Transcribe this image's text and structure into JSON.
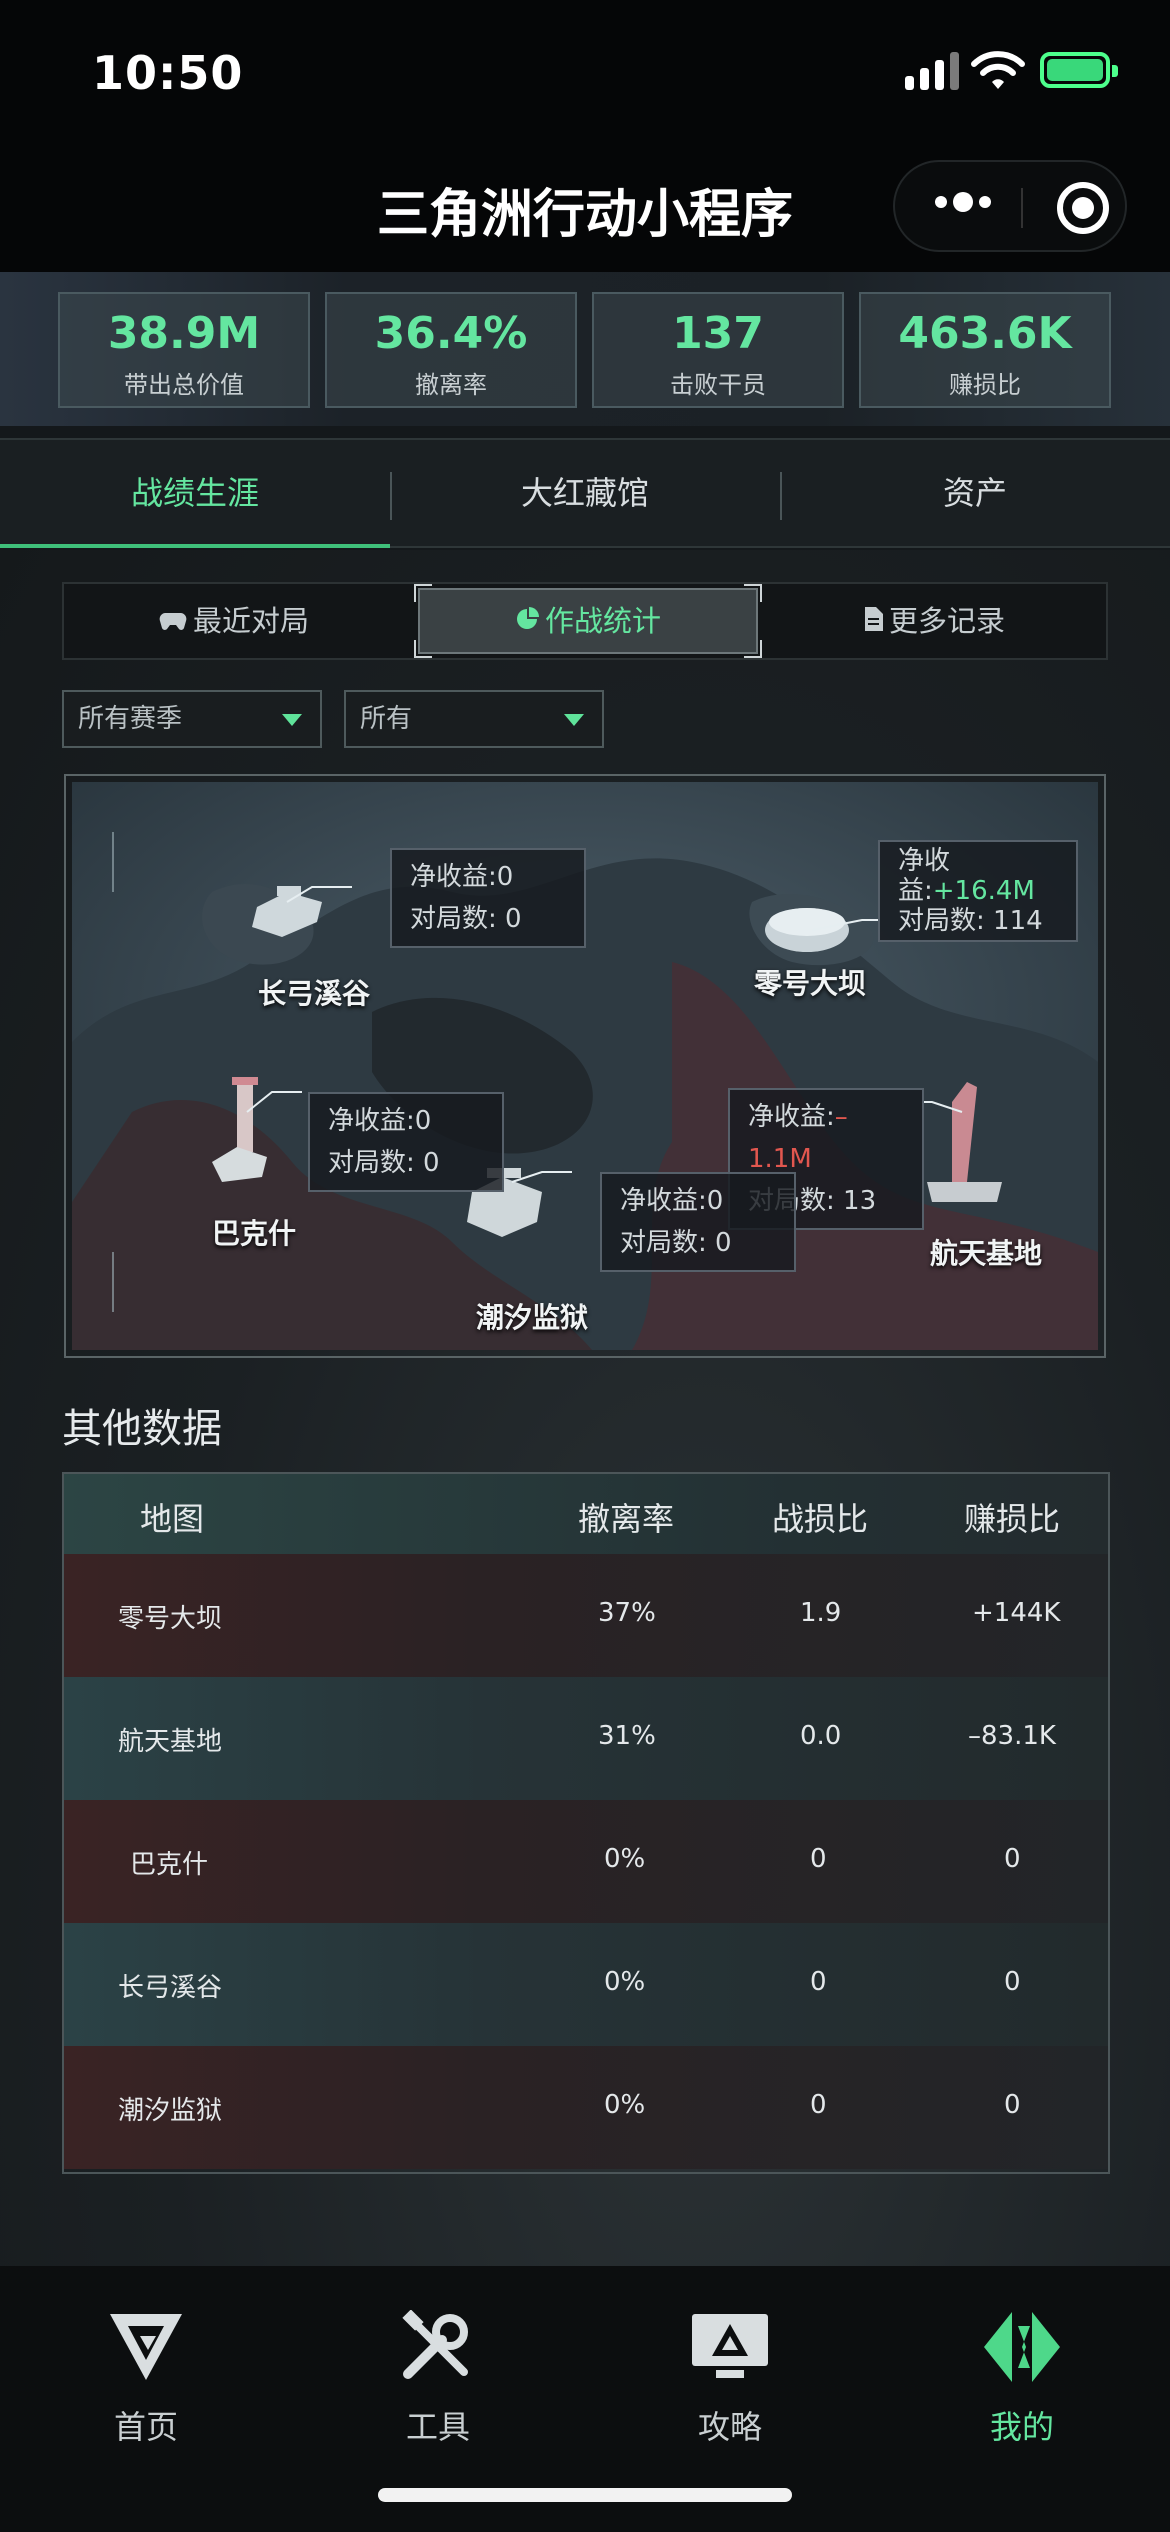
{
  "status_bar": {
    "time": "10:50"
  },
  "header": {
    "title": "三角洲行动小程序"
  },
  "stats": [
    {
      "value": "38.9M",
      "label": "带出总价值"
    },
    {
      "value": "36.4%",
      "label": "撤离率"
    },
    {
      "value": "137",
      "label": "击败干员"
    },
    {
      "value": "463.6K",
      "label": "赚损比"
    }
  ],
  "main_tabs": [
    {
      "label": "战绩生涯",
      "active": true
    },
    {
      "label": "大红藏馆",
      "active": false
    },
    {
      "label": "资产",
      "active": false
    }
  ],
  "sub_tabs": [
    {
      "label": "最近对局",
      "icon": "gamepad-icon"
    },
    {
      "label": "作战统计",
      "icon": "pie-chart-icon",
      "active": true
    },
    {
      "label": "更多记录",
      "icon": "document-icon"
    }
  ],
  "filters": {
    "season": "所有赛季",
    "mode": "所有"
  },
  "map_points": {
    "changgong": {
      "name": "长弓溪谷",
      "income_label": "净收益:",
      "income": "0",
      "matches_label": "对局数: ",
      "matches": "0"
    },
    "linghao": {
      "name": "零号大坝",
      "income_label": "净收",
      "income_label2": "益:",
      "income": "+16.4M",
      "matches_label": "对局数: ",
      "matches": "114"
    },
    "bakeshi": {
      "name": "巴克什",
      "income_label": "净收益:",
      "income": "0",
      "matches_label": "对局数: ",
      "matches": "0"
    },
    "hangtian": {
      "name": "航天基地",
      "income_label": "净收益:",
      "income": "–1.1M",
      "matches_label": "对局数: ",
      "matches": "13"
    },
    "chaoxi": {
      "name": "潮汐监狱",
      "income_label": "净收益:",
      "income": "0",
      "matches_label": "对局数: ",
      "matches": "0"
    }
  },
  "other_data": {
    "title": "其他数据",
    "columns": [
      "地图",
      "撤离率",
      "战损比",
      "赚损比"
    ],
    "rows": [
      {
        "map": "零号大坝",
        "rate": "37%",
        "kd": "1.9",
        "ratio": "+144K"
      },
      {
        "map": "航天基地",
        "rate": "31%",
        "kd": "0.0",
        "ratio": "–83.1K"
      },
      {
        "map": "巴克什",
        "rate": "0%",
        "kd": "0",
        "ratio": "0"
      },
      {
        "map": "长弓溪谷",
        "rate": "0%",
        "kd": "0",
        "ratio": "0"
      },
      {
        "map": "潮汐监狱",
        "rate": "0%",
        "kd": "0",
        "ratio": "0"
      }
    ]
  },
  "bottom_nav": [
    {
      "label": "首页",
      "icon": "delta-logo-icon"
    },
    {
      "label": "工具",
      "icon": "tools-icon"
    },
    {
      "label": "攻略",
      "icon": "monitor-guide-icon"
    },
    {
      "label": "我的",
      "icon": "profile-logo-icon",
      "active": true
    }
  ],
  "colors": {
    "accent": "#64e6a0",
    "negative": "#e2574f",
    "background": "#14181b"
  }
}
